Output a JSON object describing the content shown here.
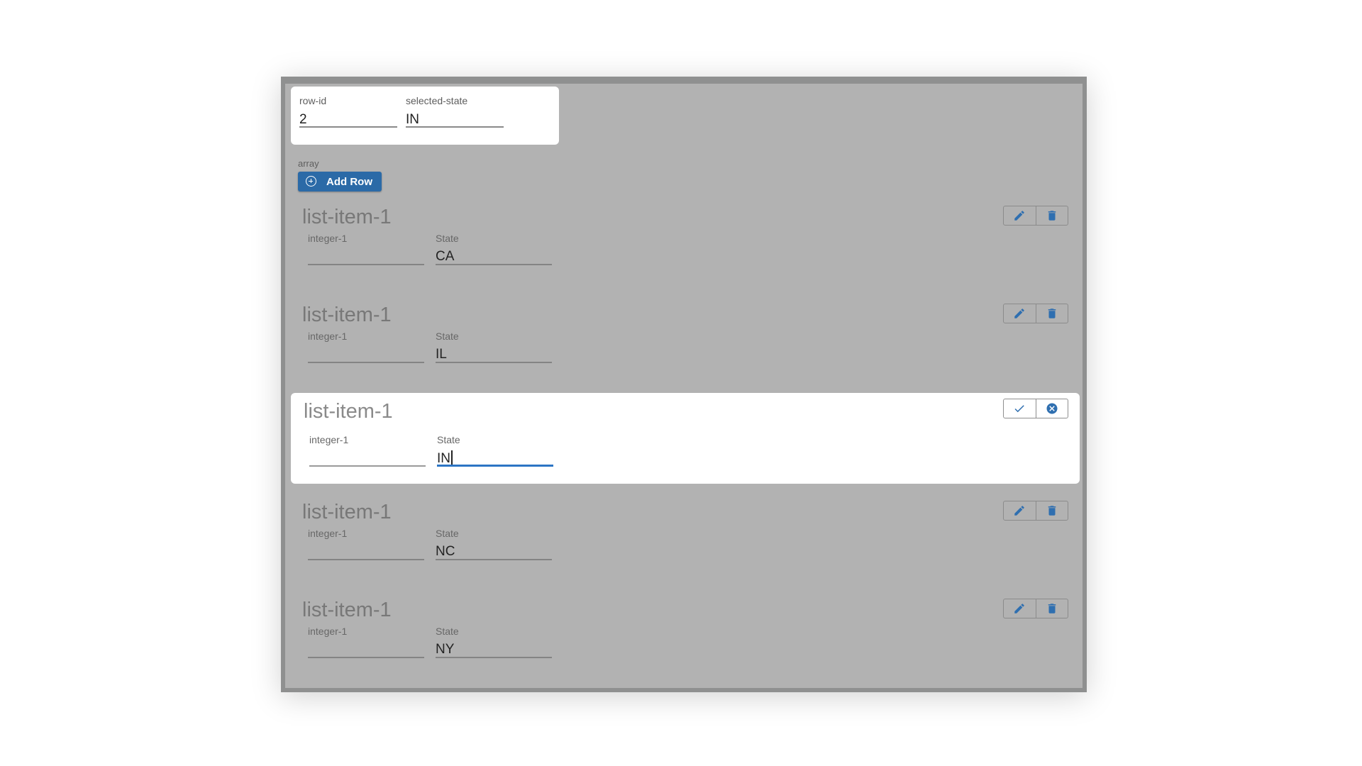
{
  "top_fields": {
    "row_id": {
      "label": "row-id",
      "value": "2"
    },
    "selected_state": {
      "label": "selected-state",
      "value": "IN"
    }
  },
  "array": {
    "label": "array",
    "add_row_label": "Add Row"
  },
  "items": [
    {
      "title": "list-item-1",
      "integer_label": "integer-1",
      "integer_value": "",
      "state_label": "State",
      "state_value": "CA",
      "mode": "view"
    },
    {
      "title": "list-item-1",
      "integer_label": "integer-1",
      "integer_value": "",
      "state_label": "State",
      "state_value": "IL",
      "mode": "view"
    },
    {
      "title": "list-item-1",
      "integer_label": "integer-1",
      "integer_value": "",
      "state_label": "State",
      "state_value": "IN",
      "mode": "edit"
    },
    {
      "title": "list-item-1",
      "integer_label": "integer-1",
      "integer_value": "",
      "state_label": "State",
      "state_value": "NC",
      "mode": "view"
    },
    {
      "title": "list-item-1",
      "integer_label": "integer-1",
      "integer_value": "",
      "state_label": "State",
      "state_value": "NY",
      "mode": "view"
    }
  ],
  "icons": {
    "view_actions": [
      "pencil-icon",
      "trash-icon"
    ],
    "edit_actions": [
      "check-icon",
      "cancel-circle-icon"
    ]
  },
  "colors": {
    "accent": "#2b6aa7",
    "icon": "#2f6fb0",
    "overlay": "#b2b2b2"
  }
}
